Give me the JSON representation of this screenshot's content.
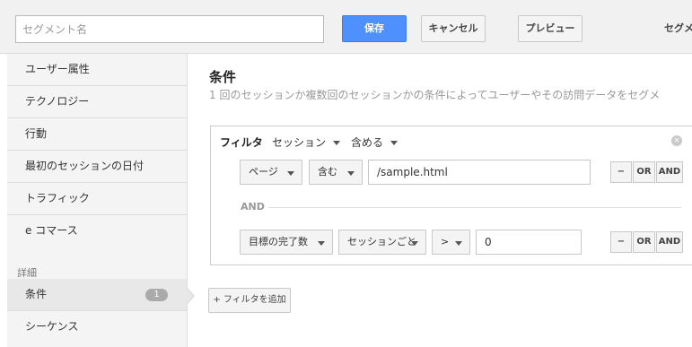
{
  "header": {
    "segment_name_placeholder": "セグメント名",
    "save_label": "保存",
    "cancel_label": "キャンセル",
    "preview_label": "プレビュー",
    "right_text": "セグメ"
  },
  "sidebar": {
    "items": [
      {
        "label": "ユーザー属性"
      },
      {
        "label": "テクノロジー"
      },
      {
        "label": "行動"
      },
      {
        "label": "最初のセッションの日付"
      },
      {
        "label": "トラフィック"
      },
      {
        "label": "e コマース"
      }
    ],
    "section_label": "詳細",
    "advanced_items": [
      {
        "label": "条件",
        "badge": "1"
      },
      {
        "label": "シーケンス"
      }
    ]
  },
  "main": {
    "title": "条件",
    "description": "1 回のセッションか複数回のセッションかの条件によってユーザーやその訪問データをセグメ",
    "filter": {
      "label": "フィルタ",
      "scope": "セッション",
      "mode": "含める",
      "close_icon": "×",
      "rows": [
        {
          "dimension": "ページ",
          "operator": "含む",
          "value": "/sample.html",
          "minus": "−",
          "or_label": "OR",
          "and_label": "AND"
        },
        {
          "dimension": "目標の完了数",
          "per": "セッションごと",
          "operator": ">",
          "value": "0",
          "minus": "−",
          "or_label": "OR",
          "and_label": "AND"
        }
      ],
      "and_separator": "AND"
    },
    "add_filter_label": "+ フィルタを追加"
  },
  "colors": {
    "accent": "#4d90fe",
    "sidebar_bg": "#f4f4f4",
    "badge_bg": "#aaaaaa"
  }
}
